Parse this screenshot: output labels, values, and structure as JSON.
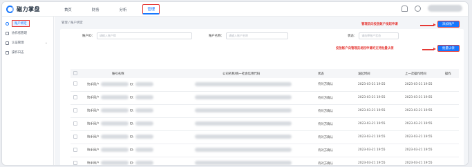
{
  "app": {
    "logo_text": "磁力掌盘",
    "colors": {
      "accent": "#1677ff",
      "highlight": "#e53935"
    }
  },
  "nav": {
    "items": [
      "首页",
      "财务",
      "分析",
      "管理"
    ],
    "active_index": 3
  },
  "sidebar": {
    "items": [
      {
        "label": "账户绑定",
        "icon": "link-icon",
        "active": true
      },
      {
        "label": "协作者管理",
        "icon": "people-icon",
        "active": false
      },
      {
        "label": "认证管理",
        "icon": "shield-icon",
        "active": false,
        "expandable": true
      },
      {
        "label": "操作日志",
        "icon": "log-icon",
        "active": false
      }
    ]
  },
  "breadcrumb": "管理 / 账户绑定",
  "filters": {
    "account_id_label": "账户ID：",
    "account_id_placeholder": "请输入账户ID",
    "account_name_label": "账户名称：",
    "account_name_placeholder": "请输入账户名称",
    "status_label": "状态：",
    "status_placeholder": "请选择账户状态"
  },
  "buttons": {
    "bind_account": "添加账户",
    "bulk_confirm": "批量认领"
  },
  "annotations": {
    "bind_note": "管理员向投放账户发起申请",
    "confirm_note": "投放账户向管理员发起申请的支持批量认领"
  },
  "table": {
    "headers": [
      "账号名称",
      "公司名称/统一社会信用代码",
      "状态",
      "发起时间",
      "上一次操作时间",
      "操作"
    ],
    "rows": [
      {
        "name": "快手用户",
        "id_suffix": "ID:",
        "status": "待对方确认",
        "created": "2023-03-21 19:55",
        "updated": "2023-03-21 19:55"
      },
      {
        "name": "快手用户",
        "id_suffix": "ID:",
        "status": "待对方确认",
        "created": "2023-03-21 19:55",
        "updated": "2023-03-21 19:55"
      },
      {
        "name": "快手用户",
        "id_suffix": "ID:",
        "status": "待对方确认",
        "created": "2023-03-21 19:55",
        "updated": "2023-03-21 19:55"
      },
      {
        "name": "快手用户",
        "id_suffix": "ID:",
        "status": "待对方确认",
        "created": "2023-03-21 19:55",
        "updated": "2023-03-21 19:55"
      },
      {
        "name": "快手用户",
        "id_suffix": "ID:",
        "status": "待对方确认",
        "created": "2023-03-21 19:55",
        "updated": "2023-03-21 19:55"
      },
      {
        "name": "快手用户",
        "id_suffix": "ID:",
        "status": "待对方确认",
        "created": "2023-03-21 19:55",
        "updated": "2023-03-21 19:55"
      },
      {
        "name": "快手用户",
        "id_suffix": "ID:",
        "status": "待对方确认",
        "created": "2023-03-21 19:55",
        "updated": "2023-03-21 19:55"
      }
    ]
  }
}
